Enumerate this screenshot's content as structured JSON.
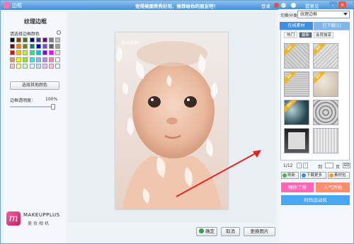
{
  "titlebar": {
    "title": "边框",
    "banner": "觉得美图秀秀好用，推荐给你的朋友吧！",
    "login": "登录",
    "mood": "提意见"
  },
  "left": {
    "panel_title": "纹理边框",
    "choose_color_label": "请选择边框颜色",
    "swatch_colors": [
      "#000000",
      "#7f3f00",
      "#3f7f00",
      "#00007f",
      "#3f3f7f",
      "#7f007f",
      "#7f7f7f",
      "#c0c0c0",
      "#7f0000",
      "#ff7f00",
      "#7f7f00",
      "#007f7f",
      "#0000ff",
      "#7f3fff",
      "#5f5f5f",
      "#a0a0a0",
      "#ff0000",
      "#ffbf00",
      "#bfff00",
      "#00ff7f",
      "#00bfff",
      "#7f00ff",
      "#ff00ff",
      "#dfdfdf",
      "#ff7f7f",
      "#ffff00",
      "#7fff00",
      "#00ffff",
      "#7fbfff",
      "#bf7fff",
      "#ff7fbf",
      "#ffffff",
      "#ffbfbf",
      "#ffff7f",
      "#bfffbf",
      "#bfffff",
      "#bfdfff",
      "#dfbfff",
      "#ffbfdf",
      "#f0f0f0"
    ],
    "other_color_button": "选择其他颜色",
    "opacity_label": "边框透明度：",
    "opacity_value": "100%",
    "opacity_fraction": 1.0
  },
  "logo": {
    "brand": "MAKEUPPLUS",
    "sub": "美妆相机"
  },
  "bottom": {
    "ok": "确定",
    "cancel": "取消",
    "replace": "更换图片"
  },
  "right": {
    "category_label": "切换分类",
    "category_value": "纹理边框",
    "tab_online": "在线素材",
    "tab_downloaded": "已下载(1)",
    "sub_tabs": [
      "热门",
      "最新",
      "会员独享"
    ],
    "selected_sub_tab": "最新",
    "new_tag": "最新",
    "pager_text": "1/12",
    "page_jump_label": "到",
    "page_unit": "页",
    "go": "GO",
    "refresh": "刷新",
    "download_more": "下载更多",
    "material_pack": "素材包"
  },
  "promo": {
    "a": "嘀你了呀",
    "b": "人气开始",
    "c": "时尚运动风"
  },
  "photo": {
    "watermark": "美图秀秀"
  },
  "colors": {
    "accent": "#3d8ee0",
    "promo_a": "#ff66b8",
    "promo_b": "#ff8c6b",
    "promo_c": "#49a7f2"
  }
}
